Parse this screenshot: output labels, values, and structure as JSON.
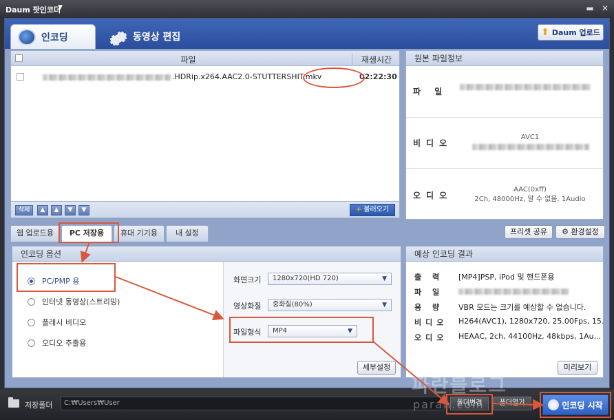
{
  "titlebar": {
    "title": "Daum 팟인코더",
    "menu_caret": "▼",
    "minimize": "▬",
    "close": "✕"
  },
  "main_tabs": {
    "encoding": "인코딩",
    "edit": "동영상 편집",
    "upload_button": "Daum 업로드"
  },
  "file_list": {
    "col_file": "파일",
    "col_time": "재생시간",
    "rows": [
      {
        "name": ".HDRip.x264.AAC2.0-STUTTERSHIT.mkv",
        "time": "02:22:30"
      }
    ],
    "toolbar": {
      "delete": "삭제",
      "top": "▲",
      "up": "▲",
      "down": "▼",
      "bottom": "▼",
      "load": "불러오기"
    }
  },
  "original_info": {
    "title": "원본 파일정보",
    "file_label": "파 일",
    "video_label": "비디오",
    "video_value": "AVC1",
    "audio_label": "오디오",
    "audio_value_1": "AAC(0xff)",
    "audio_value_2": "2Ch, 48000Hz, 알 수 없음, 1Audio"
  },
  "sub_tabs": [
    "웹 업로드용",
    "PC 저장용",
    "휴대 기기용",
    "내 설정"
  ],
  "preset_buttons": {
    "share": "프리셋 공유",
    "settings": "환경설정"
  },
  "encoding_options": {
    "title": "인코딩 옵션",
    "radios": [
      "PC/PMP 용",
      "인터넷 동영상(스트리밍)",
      "플래시 비디오",
      "오디오 추출용"
    ],
    "selected": 0,
    "screen_size_label": "화면크기",
    "screen_size_value": "1280x720(HD 720)",
    "quality_label": "영상화질",
    "quality_value": "중화질(80%)",
    "format_label": "파일형식",
    "format_value": "MP4",
    "detail_button": "세부설정"
  },
  "expected_result": {
    "title": "예상 인코딩 결과",
    "rows": [
      {
        "label": "출 력",
        "value": "[MP4]PSP, iPod 및 핸드폰용"
      },
      {
        "label": "파 일",
        "value": ""
      },
      {
        "label": "용 량",
        "value": "VBR 모드는 크기를 예상할 수 없습니다."
      },
      {
        "label": "비디오",
        "value": "H264(AVC1), 1280x720, 25.00Fps, 15..."
      },
      {
        "label": "오디오",
        "value": "HEAAC, 2ch, 44100Hz, 48kbps, 1Au..."
      }
    ],
    "preview_button": "미리보기"
  },
  "bottom": {
    "save_folder_label": "저장폴더",
    "path": "C:₩Users₩User",
    "change_folder": "폴더변경",
    "open_folder": "폴더열기",
    "start": "인코딩 시작"
  },
  "watermark": {
    "line1": "파란블로그",
    "line2": "paran.com"
  },
  "colors": {
    "accent_blue": "#2d5fc2",
    "annotation_red": "#d9583b"
  }
}
